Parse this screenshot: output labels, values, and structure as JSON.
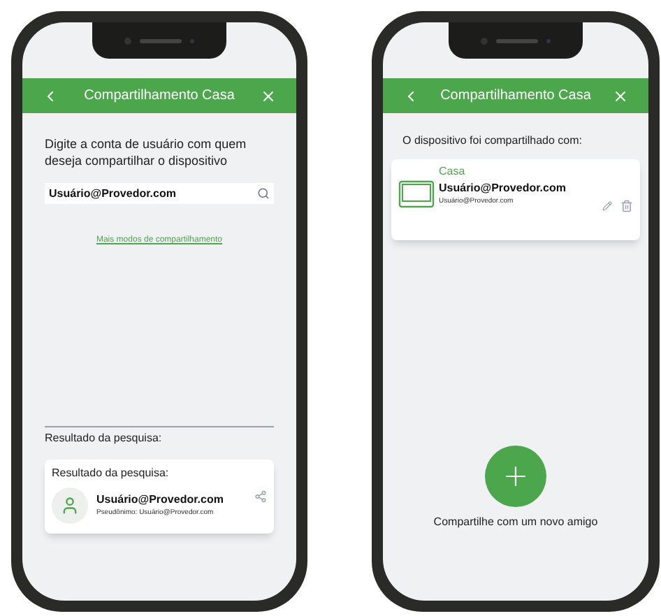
{
  "phones": [
    {
      "kind": "search",
      "header": {
        "title": "Compartilhamento Casa"
      },
      "prompt": "Digite a conta de usuário com quem deseja compartilhar o dispositivo",
      "search": {
        "value": "Usuário@Provedor.com"
      },
      "link": "Mais modos de compartilhamento",
      "section_label": "Resultado da pesquisa:",
      "result": {
        "title": "Resultado da pesquisa:",
        "name": "Usuário@Provedor.com",
        "alias": "Pseudônimo: Usuário@Provedor.com"
      }
    },
    {
      "kind": "shared",
      "header": {
        "title": "Compartilhamento Casa"
      },
      "prompt": "O dispositivo foi compartilhado com:",
      "device": {
        "room": "Casa",
        "name": "Usuário@Provedor.com",
        "account": "Usuário@Provedor.com"
      },
      "add_label": "Compartilhe com um novo amigo"
    }
  ]
}
